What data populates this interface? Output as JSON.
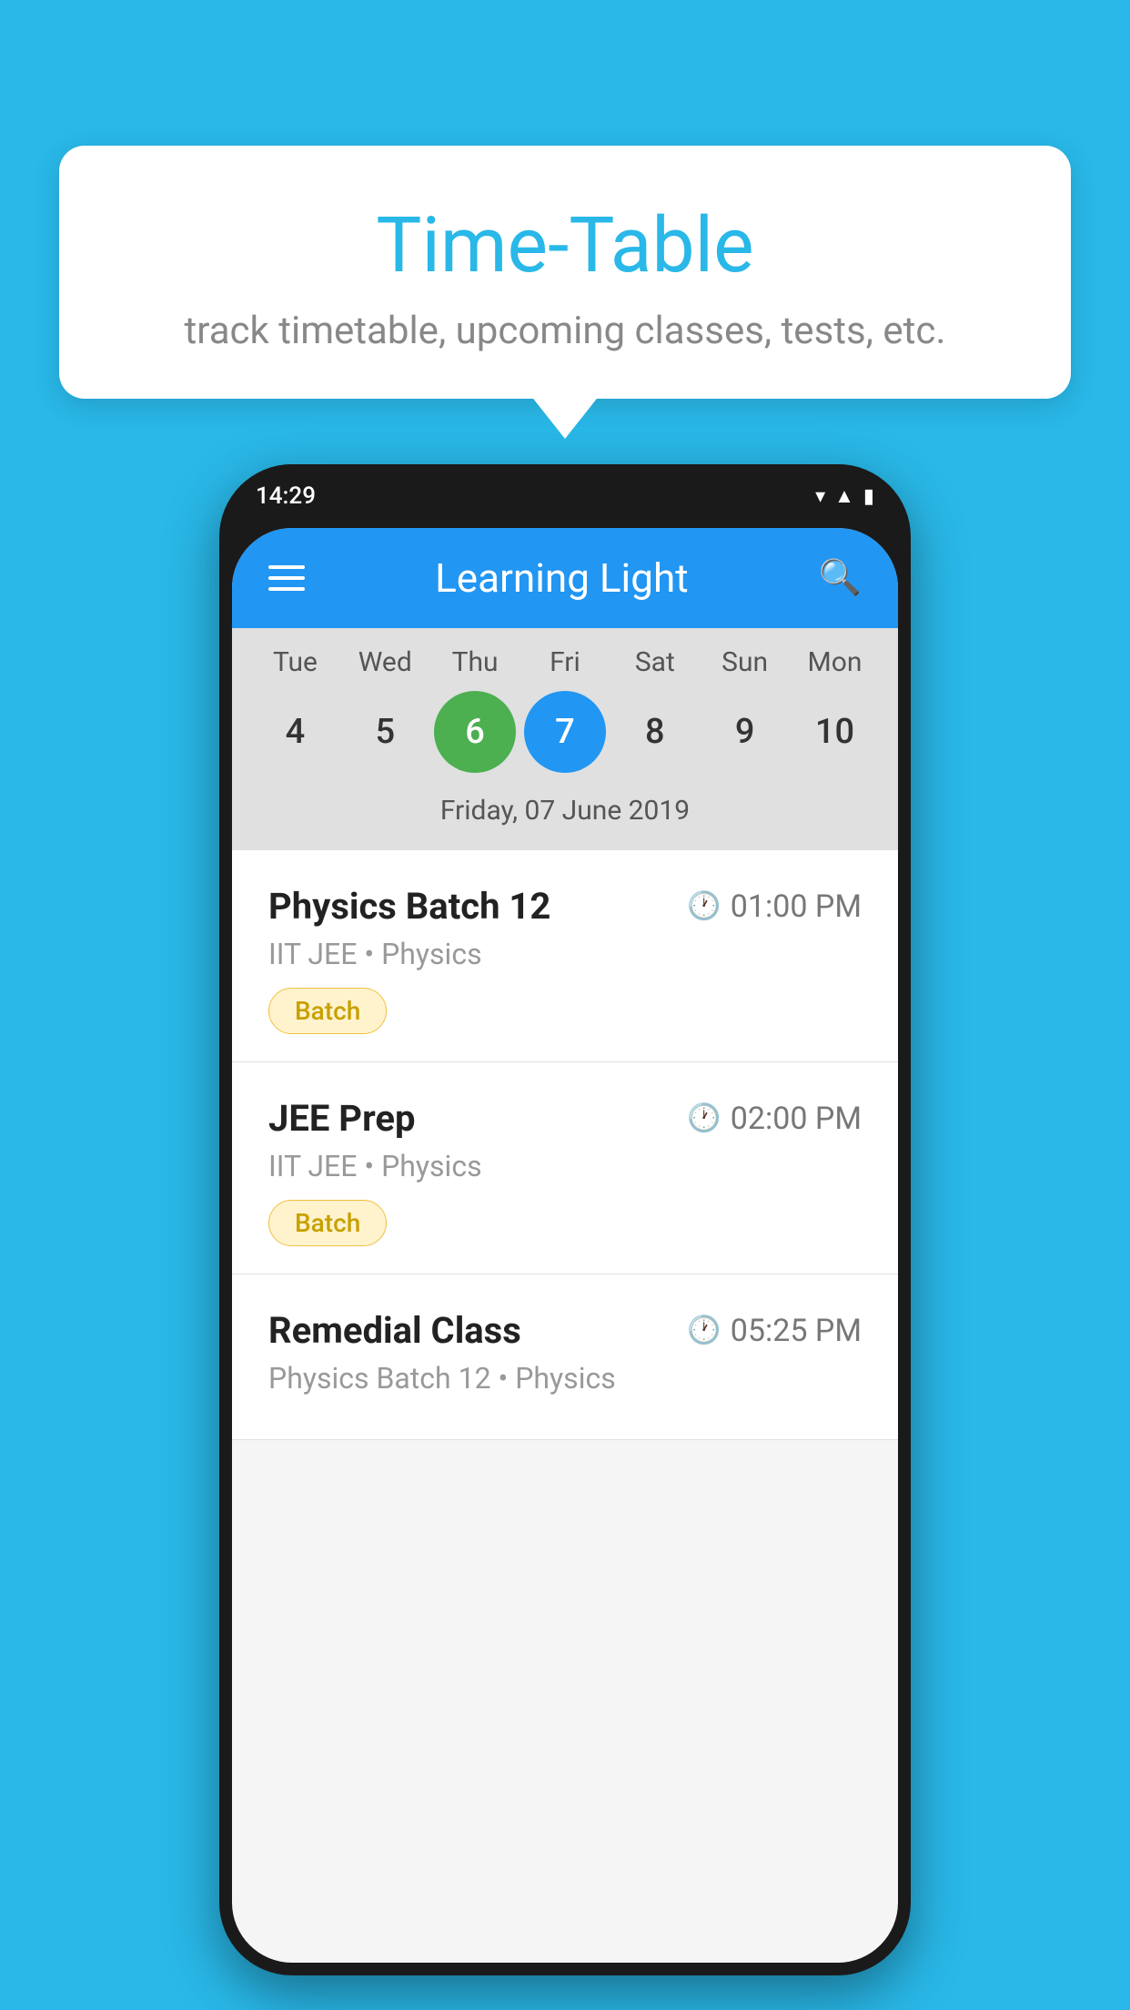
{
  "background_color": "#29b8e8",
  "tooltip": {
    "title": "Time-Table",
    "subtitle": "track timetable, upcoming classes, tests, etc."
  },
  "phone": {
    "status_bar": {
      "time": "14:29"
    },
    "app_bar": {
      "title": "Learning Light"
    },
    "calendar": {
      "days": [
        "Tue",
        "Wed",
        "Thu",
        "Fri",
        "Sat",
        "Sun",
        "Mon"
      ],
      "dates": [
        "4",
        "5",
        "6",
        "7",
        "8",
        "9",
        "10"
      ],
      "today_index": 2,
      "selected_index": 3,
      "selected_date_label": "Friday, 07 June 2019"
    },
    "schedule": [
      {
        "name": "Physics Batch 12",
        "time": "01:00 PM",
        "sub": "IIT JEE • Physics",
        "badge": "Batch"
      },
      {
        "name": "JEE Prep",
        "time": "02:00 PM",
        "sub": "IIT JEE • Physics",
        "badge": "Batch"
      },
      {
        "name": "Remedial Class",
        "time": "05:25 PM",
        "sub": "Physics Batch 12 • Physics",
        "badge": null
      }
    ]
  }
}
